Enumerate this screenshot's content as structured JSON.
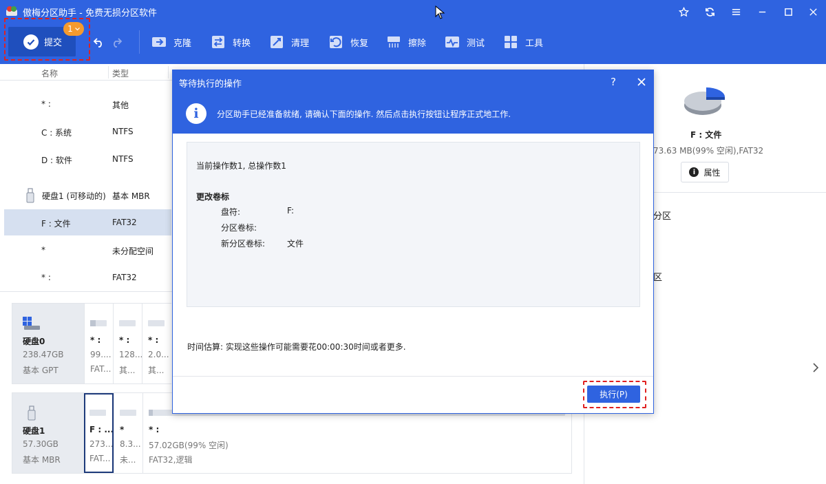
{
  "app": {
    "title": "傲梅分区助手 - 免费无损分区软件"
  },
  "toolbar": {
    "submit_label": "提交",
    "pending_badge": "1",
    "tools": [
      {
        "label": "克隆",
        "icon": "clone-icon"
      },
      {
        "label": "转换",
        "icon": "convert-icon"
      },
      {
        "label": "清理",
        "icon": "clean-icon"
      },
      {
        "label": "恢复",
        "icon": "recover-icon"
      },
      {
        "label": "擦除",
        "icon": "wipe-icon"
      },
      {
        "label": "测试",
        "icon": "test-icon"
      },
      {
        "label": "工具",
        "icon": "tools-icon"
      }
    ]
  },
  "list": {
    "headers": [
      "名称",
      "类型"
    ],
    "rows": [
      {
        "name": "* :",
        "type": "其他"
      },
      {
        "name": "C : 系统",
        "type": "NTFS"
      },
      {
        "name": "D : 软件",
        "type": "NTFS"
      },
      {
        "name": "硬盘1 (可移动的)",
        "type": "基本 MBR"
      },
      {
        "name": "F : 文件",
        "type": "FAT32"
      },
      {
        "name": "*",
        "type": "未分配空间"
      },
      {
        "name": "* :",
        "type": "FAT32"
      }
    ]
  },
  "disks": [
    {
      "name": "硬盘0",
      "size": "238.47GB",
      "type": "基本 GPT",
      "partitions": [
        {
          "name": "* :",
          "size": "99....",
          "fs": "FAT...",
          "usage": 0.35
        },
        {
          "name": "* :",
          "size": "128...",
          "fs": "其...",
          "usage": 0.0
        },
        {
          "name": "* :",
          "size": "2.0...",
          "fs": "其...",
          "usage": 0.0
        }
      ]
    },
    {
      "name": "硬盘1",
      "size": "57.30GB",
      "type": "基本 MBR",
      "partitions": [
        {
          "name": "F : ...",
          "size": "273....",
          "fs": "FAT...",
          "usage": 0.0
        },
        {
          "name": "*",
          "size": "8.3...",
          "fs": "未...",
          "usage": 0.0
        },
        {
          "name": "* :",
          "size": "57.02GB(99% 空闲)",
          "fs": "FAT32,逻辑",
          "usage": 0.01
        }
      ]
    }
  ],
  "right_panel": {
    "partition_name": "F : 文件",
    "partition_info": "73.63 MB(99% 空闲),FAT32",
    "properties_label": "属性",
    "item1": "分区",
    "item2": "区"
  },
  "modal": {
    "title": "等待执行的操作",
    "help": "?",
    "info_text": "分区助手已经准备就绪, 请确认下面的操作. 然后点击执行按钮让程序正式地工作.",
    "op_count": "当前操作数1, 总操作数1",
    "op_title": "更改卷标",
    "details": [
      {
        "key": "盘符:",
        "value": "F:"
      },
      {
        "key": "分区卷标:",
        "value": ""
      },
      {
        "key": "新分区卷标:",
        "value": "文件"
      }
    ],
    "estimate": "时间估算: 实现这些操作可能需要花00:00:30时间或者更多.",
    "execute_label": "执行(P)"
  },
  "colors": {
    "primary": "#2f63e0",
    "submit_bg": "#1f4fbd",
    "badge": "#f59a2e",
    "highlight_dash": "#e02020",
    "selected_row": "#d6e0f0"
  }
}
